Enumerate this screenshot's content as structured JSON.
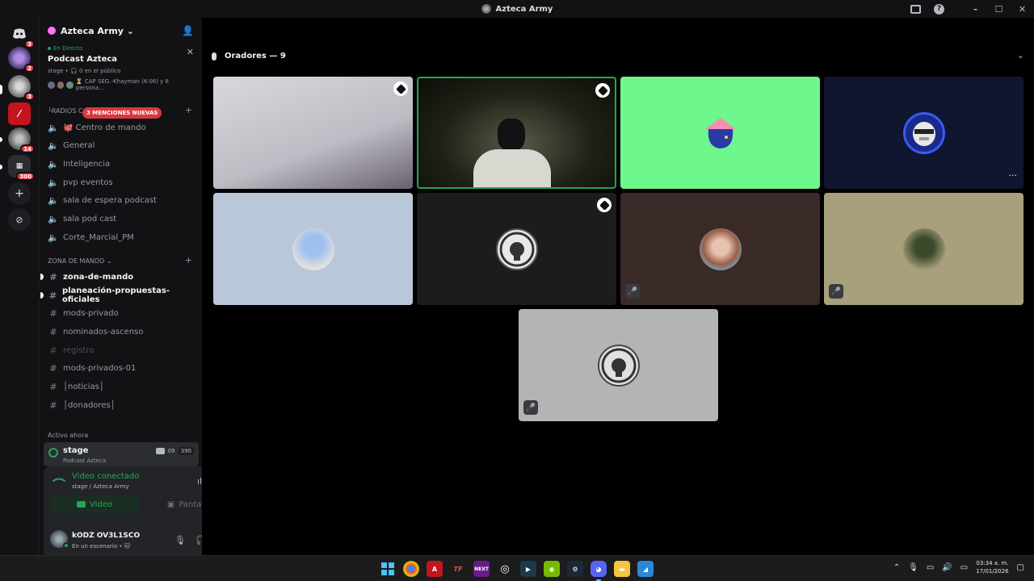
{
  "window": {
    "title": "Azteca Army"
  },
  "rail": {
    "badges": [
      "3",
      "2",
      "3",
      "14",
      "300"
    ]
  },
  "server": {
    "name": "Azteca Army ⌄"
  },
  "live": {
    "status": "En Directo",
    "title": "Podcast Azteca",
    "meta": "stage • 🎧 0 en el público",
    "speakers": "⏳ CAP SEG.-Khayman (K-06) y 8 persona..."
  },
  "categories": {
    "radios": "└RADIOS C",
    "mentions": "3 MENCIONES NUEVAS",
    "zona": "ZONA DE MANDO ⌄"
  },
  "voice_channels": [
    {
      "label": "🐙 Centro de mando"
    },
    {
      "label": "General"
    },
    {
      "label": "Inteligencia"
    },
    {
      "label": "pvp eventos"
    },
    {
      "label": "sala de espera podcast"
    },
    {
      "label": "sala pod cast"
    },
    {
      "label": "Corte_Marcial_PM"
    }
  ],
  "text_channels": [
    {
      "label": "zona-de-mando"
    },
    {
      "label": "planeación-propuestas-oficiales"
    },
    {
      "label": "mods-privado"
    },
    {
      "label": "nominados-ascenso"
    },
    {
      "label": "registro"
    },
    {
      "label": "mods-privados-01"
    },
    {
      "label": "│noticias│"
    },
    {
      "label": "│donadores│"
    }
  ],
  "active_now": {
    "heading": "Activo ahora",
    "stage_name": "stage",
    "stage_sub": "Podcast Azteca",
    "video_count": "09",
    "listeners": "390"
  },
  "voice_panel": {
    "status": "Video conectado",
    "sub": "stage / Azteca Army",
    "video_label": "Video",
    "screen_label": "Pantalla"
  },
  "user": {
    "name": "kODZ OV3L1SCO",
    "status": "En un escenario • 🐱"
  },
  "stage": {
    "header": "Oradores — 9",
    "tiles": [
      {
        "kind": "video",
        "bg": "#cfcfd3",
        "mod": true,
        "muted": false
      },
      {
        "kind": "video",
        "bg": "#1d2116",
        "mod": true,
        "muted": false,
        "speaking": true
      },
      {
        "kind": "avatar",
        "bg": "#6df78d",
        "mod": false,
        "muted": false
      },
      {
        "kind": "avatar",
        "bg": "#101530",
        "mod": false,
        "muted": false,
        "more": "···"
      },
      {
        "kind": "avatar",
        "bg": "#b8c8d8",
        "mod": false,
        "muted": false
      },
      {
        "kind": "avatar",
        "bg": "#1c1c1c",
        "mod": true,
        "muted": false
      },
      {
        "kind": "avatar",
        "bg": "#3a2a28",
        "mod": false,
        "muted": true
      },
      {
        "kind": "avatar",
        "bg": "#a89f7c",
        "mod": false,
        "muted": true
      },
      {
        "kind": "avatar",
        "bg": "#b4b4b4",
        "mod": false,
        "muted": true
      }
    ]
  },
  "taskbar": {
    "time": "03:34 a. m.",
    "date": "17/01/2026"
  },
  "colors": {
    "accent_green": "#23a55a",
    "danger_red": "#da373c",
    "sidebar_bg": "#121214"
  }
}
